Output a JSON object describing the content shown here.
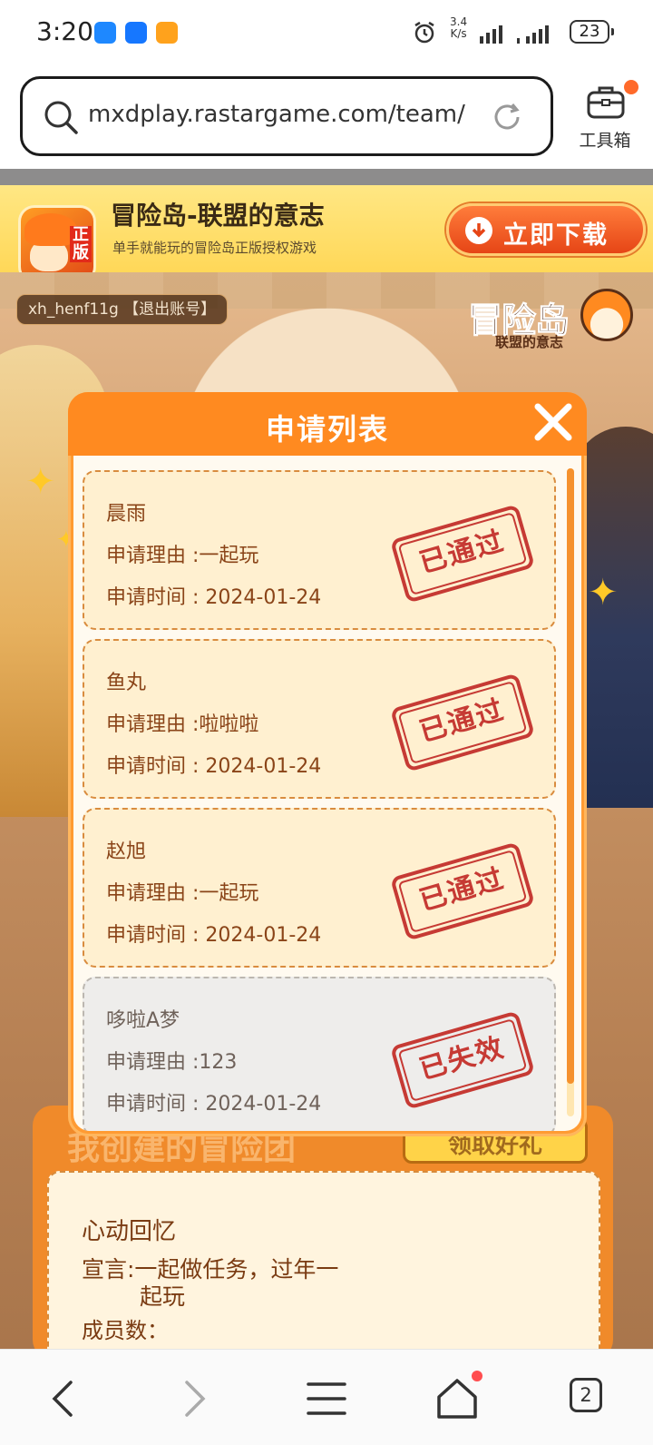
{
  "status_bar": {
    "time": "3:20",
    "net_speed_top": "3.4",
    "net_speed_unit": "K/s",
    "battery": "23",
    "apps": [
      "message-icon",
      "alipay-icon",
      "app-icon"
    ]
  },
  "browser": {
    "url": "mxdplay.rastargame.com/team/",
    "toolbox_label": "工具箱"
  },
  "banner": {
    "title": "冒险岛-联盟的意志",
    "subtitle": "单手就能玩的冒险岛正版授权游戏",
    "download_label": "立即下载",
    "app_icon_text": "正版"
  },
  "page": {
    "account_text": "xh_henf11g 【退出账号】",
    "logo_main": "冒险岛",
    "logo_sub": "联盟的意志"
  },
  "modal": {
    "title": "申请列表",
    "requests": [
      {
        "name": "晨雨",
        "reason": "申请理由 :一起玩",
        "time": "申请时间 : 2024-01-24",
        "status": "已通过",
        "expired": false
      },
      {
        "name": "鱼丸",
        "reason": "申请理由 :啦啦啦",
        "time": "申请时间 : 2024-01-24",
        "status": "已通过",
        "expired": false
      },
      {
        "name": "赵旭",
        "reason": "申请理由 :一起玩",
        "time": "申请时间 : 2024-01-24",
        "status": "已通过",
        "expired": false
      },
      {
        "name": "哆啦A梦",
        "reason": "申请理由 :123",
        "time": "申请时间 : 2024-01-24",
        "status": "已失效",
        "expired": true
      }
    ]
  },
  "team_card": {
    "heading": "我创建的冒险团",
    "gift_button": "领取好礼",
    "team_name": "心动回忆",
    "declaration_line1": "宣言:一起做任务，过年一",
    "declaration_line2": "起玩",
    "members_partial": "成员数："
  },
  "bottom_nav": {
    "tab_count": "2"
  },
  "colors": {
    "accent_orange": "#ff8a20",
    "stamp_red": "#c63a34",
    "card_text_brown": "#8a4418"
  }
}
